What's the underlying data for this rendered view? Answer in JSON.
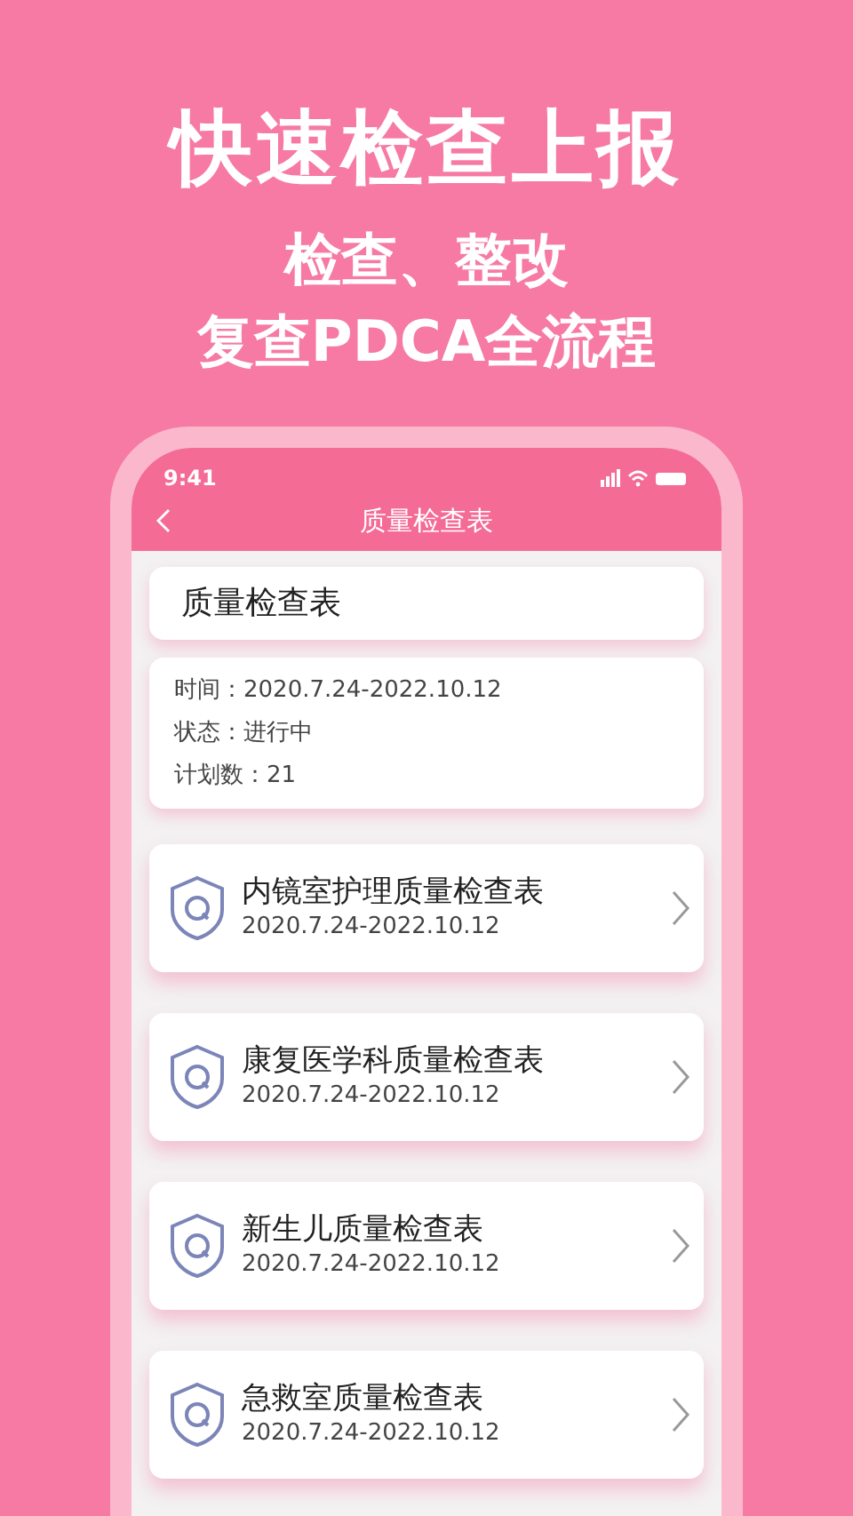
{
  "headline": "快速检查上报",
  "subtitle_lines": [
    "检查、整改",
    "复查PDCA全流程"
  ],
  "status_bar": {
    "time": "9:41"
  },
  "nav": {
    "title": "质量检查表"
  },
  "summary": {
    "title": "质量检查表",
    "details": [
      {
        "label": "时间：",
        "value": "2020.7.24-2022.10.12"
      },
      {
        "label": "状态：",
        "value": "进行中"
      },
      {
        "label": "计划数：",
        "value": "21"
      }
    ]
  },
  "forms": [
    {
      "name": "内镜室护理质量检查表",
      "dates": "2020.7.24-2022.10.12"
    },
    {
      "name": "康复医学科质量检查表",
      "dates": "2020.7.24-2022.10.12"
    },
    {
      "name": "新生儿质量检查表",
      "dates": "2020.7.24-2022.10.12"
    },
    {
      "name": "急救室质量检查表",
      "dates": "2020.7.24-2022.10.12"
    }
  ]
}
